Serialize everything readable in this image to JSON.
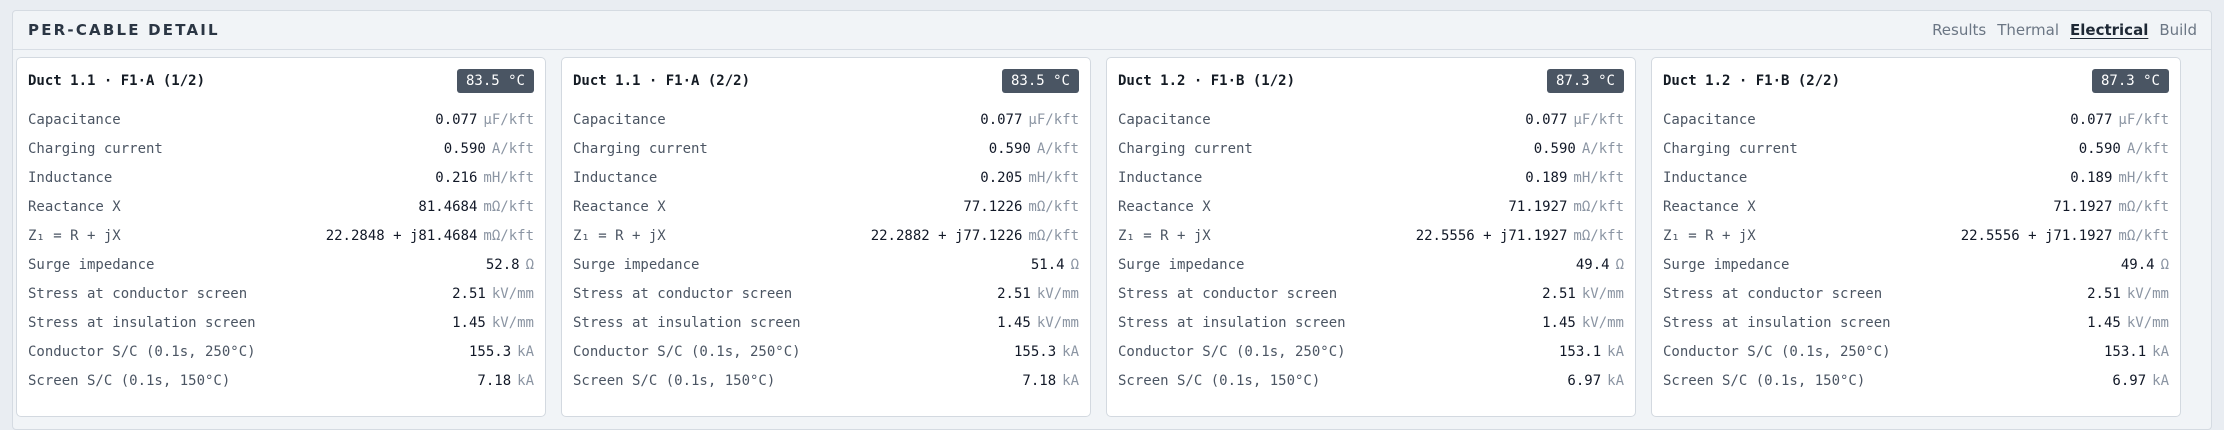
{
  "panel": {
    "title": "PER-CABLE DETAIL",
    "tabs": [
      {
        "label": "Results",
        "active": false
      },
      {
        "label": "Thermal",
        "active": false
      },
      {
        "label": "Electrical",
        "active": true
      },
      {
        "label": "Build",
        "active": false
      }
    ]
  },
  "row_labels": [
    "Capacitance",
    "Charging current",
    "Inductance",
    "Reactance X",
    "Z₁ = R + jX",
    "Surge impedance",
    "Stress at conductor screen",
    "Stress at insulation screen",
    "Conductor S/C (0.1s, 250°C)",
    "Screen S/C (0.1s, 150°C)"
  ],
  "row_units": [
    "µF/kft",
    "A/kft",
    "mH/kft",
    "mΩ/kft",
    "mΩ/kft",
    "Ω",
    "kV/mm",
    "kV/mm",
    "kA",
    "kA"
  ],
  "cards": [
    {
      "title": "Duct 1.1 · F1·A (1/2)",
      "temperature": "83.5 °C",
      "values": [
        "0.077",
        "0.590",
        "0.216",
        "81.4684",
        "22.2848 + j81.4684",
        "52.8",
        "2.51",
        "1.45",
        "155.3",
        "7.18"
      ]
    },
    {
      "title": "Duct 1.1 · F1·A (2/2)",
      "temperature": "83.5 °C",
      "values": [
        "0.077",
        "0.590",
        "0.205",
        "77.1226",
        "22.2882 + j77.1226",
        "51.4",
        "2.51",
        "1.45",
        "155.3",
        "7.18"
      ]
    },
    {
      "title": "Duct 1.2 · F1·B (1/2)",
      "temperature": "87.3 °C",
      "values": [
        "0.077",
        "0.590",
        "0.189",
        "71.1927",
        "22.5556 + j71.1927",
        "49.4",
        "2.51",
        "1.45",
        "153.1",
        "6.97"
      ]
    },
    {
      "title": "Duct 1.2 · F1·B (2/2)",
      "temperature": "87.3 °C",
      "values": [
        "0.077",
        "0.590",
        "0.189",
        "71.1927",
        "22.5556 + j71.1927",
        "49.4",
        "2.51",
        "1.45",
        "153.1",
        "6.97"
      ]
    }
  ]
}
